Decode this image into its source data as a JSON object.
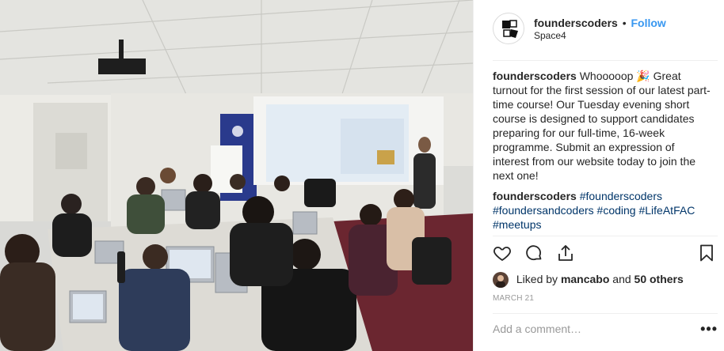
{
  "post": {
    "username": "founderscoders",
    "separator": "•",
    "follow_label": "Follow",
    "location": "Space4"
  },
  "caption": {
    "author": "founderscoders",
    "text": "Whooooop 🎉 Great turnout for the first session of our latest part-time course! Our Tuesday evening short course is designed to support candidates preparing for our full-time, 16-week programme. Submit an expression of interest from our website today to join the next one!"
  },
  "hashtags_comment": {
    "author": "founderscoders",
    "tags": [
      "#founderscoders",
      "#foundersandcoders",
      "#coding",
      "#LifeAtFAC",
      "#meetups"
    ]
  },
  "likes": {
    "prefix": "Liked by",
    "user": "mancabo",
    "conj": "and",
    "others": "50 others"
  },
  "date": "MARCH 21",
  "comment_input": {
    "placeholder": "Add a comment…"
  },
  "more_label": "•••",
  "icons": {
    "like": "heart-icon",
    "comment": "comment-icon",
    "share": "share-icon",
    "save": "bookmark-icon",
    "more": "more-options-icon"
  },
  "colors": {
    "link": "#3897f0",
    "hashtag": "#003569",
    "muted": "#999999",
    "text": "#262626"
  }
}
